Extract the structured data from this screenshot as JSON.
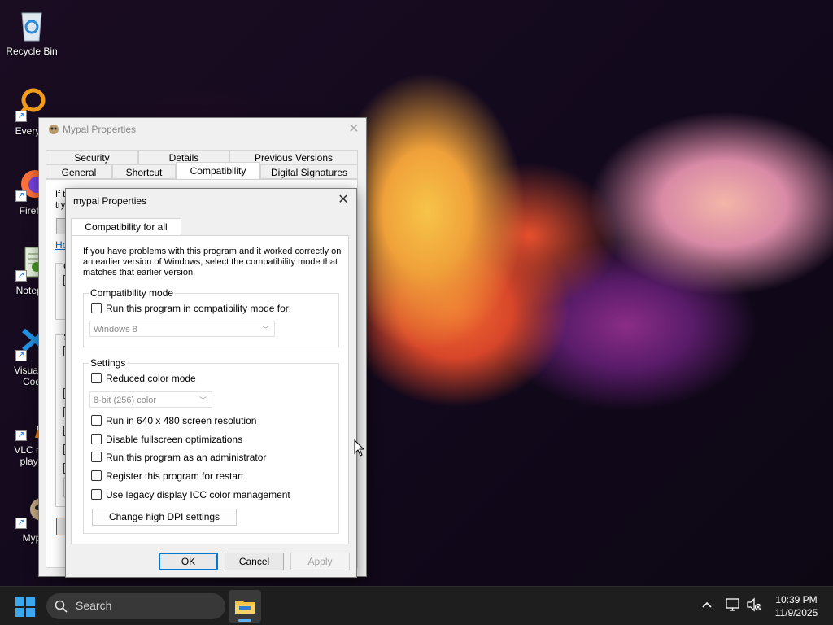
{
  "desktop": {
    "icons": [
      {
        "label": "Recycle Bin",
        "icon": "recycle-bin-icon"
      },
      {
        "label": "Everyth",
        "icon": "everything-search-icon"
      },
      {
        "label": "Firefo",
        "icon": "firefox-icon"
      },
      {
        "label": "Notepa",
        "icon": "notepad-icon"
      },
      {
        "label": "Visual S",
        "label2": "Cod",
        "icon": "vscode-icon"
      },
      {
        "label": "VLC me",
        "label2": "playe",
        "icon": "vlc-icon"
      },
      {
        "label": "Myp",
        "icon": "mypal-icon"
      }
    ]
  },
  "outer_dialog": {
    "title": "Mypal Properties",
    "tabs_row1": [
      "Security",
      "Details",
      "Previous Versions"
    ],
    "tabs_row2": [
      "General",
      "Shortcut",
      "Compatibility",
      "Digital Signatures"
    ],
    "active_tab": "Compatibility",
    "peek_text_1": "If t",
    "peek_text_2": "try",
    "peek_link": "Ho",
    "peek_c": "C",
    "peek_s": "S"
  },
  "inner_dialog": {
    "title": "mypal Properties",
    "tab": "Compatibility for all users",
    "intro": "If you have problems with this program and it worked correctly on an earlier version of Windows, select the compatibility mode that matches that earlier version.",
    "compat_mode": {
      "group_label": "Compatibility mode",
      "checkbox_label": "Run this program in compatibility mode for:",
      "os_value": "Windows 8"
    },
    "settings": {
      "group_label": "Settings",
      "reduced_color": "Reduced color mode",
      "color_value": "8-bit (256) color",
      "options": [
        "Run in 640 x 480 screen resolution",
        "Disable fullscreen optimizations",
        "Run this program as an administrator",
        "Register this program for restart",
        "Use legacy display ICC color management"
      ],
      "dpi_button": "Change high DPI settings"
    },
    "buttons": {
      "ok": "OK",
      "cancel": "Cancel",
      "apply": "Apply"
    }
  },
  "taskbar": {
    "search_placeholder": "Search",
    "time": "10:39 PM",
    "date": "11/9/2025"
  }
}
